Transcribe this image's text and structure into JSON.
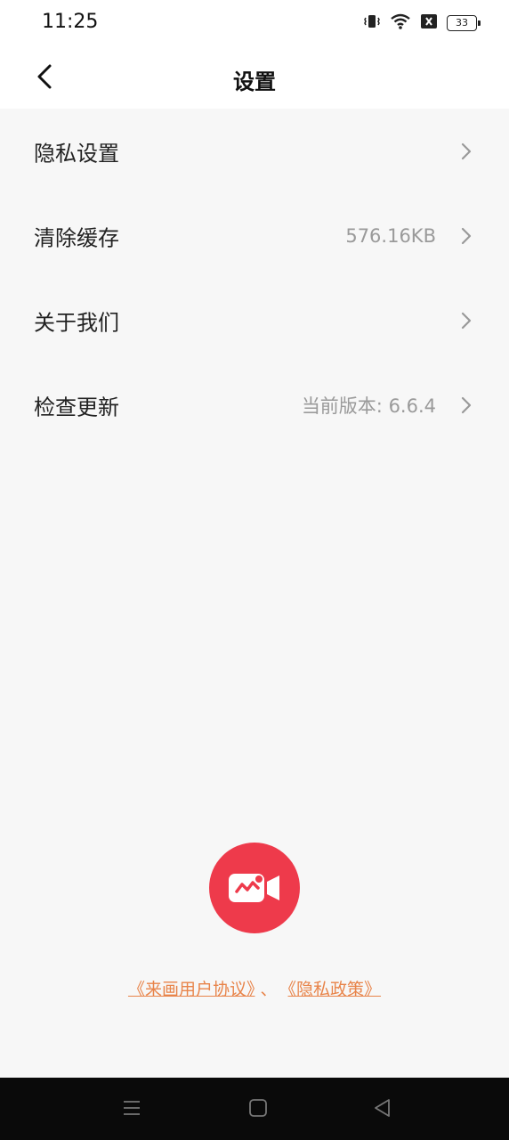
{
  "status_bar": {
    "time": "11:25",
    "battery": "33",
    "icons": [
      "vibrate-icon",
      "wifi-icon",
      "no-sim-icon",
      "battery-icon"
    ]
  },
  "header": {
    "title": "设置",
    "back_icon": "chevron-left-icon"
  },
  "settings": {
    "items": [
      {
        "label": "隐私设置",
        "value": ""
      },
      {
        "label": "清除缓存",
        "value": "576.16KB"
      },
      {
        "label": "关于我们",
        "value": ""
      },
      {
        "label": "检查更新",
        "value": "当前版本: 6.6.4"
      }
    ]
  },
  "footer": {
    "logo_icon": "video-camera-logo-icon",
    "user_agreement": "《来画用户协议》",
    "separator": "、",
    "privacy_policy": "《隐私政策》"
  },
  "system_nav": {
    "icons": [
      "menu-icon",
      "home-icon",
      "back-triangle-icon"
    ]
  },
  "colors": {
    "background": "#f7f7f7",
    "accent_logo": "#ee3a4b",
    "link": "#e8844a",
    "value_text": "#9a9a9a"
  }
}
